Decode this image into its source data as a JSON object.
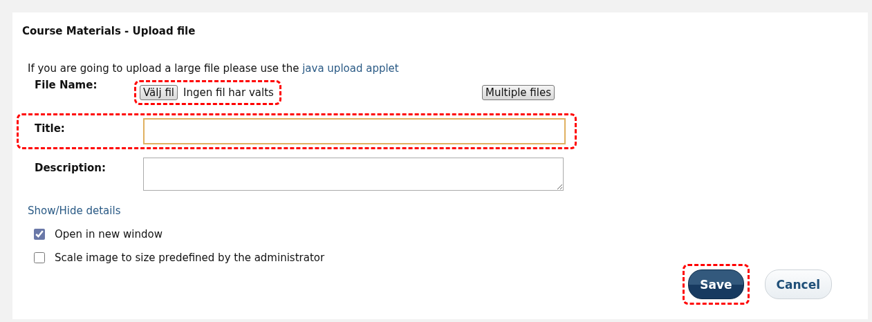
{
  "heading": "Course Materials - Upload file",
  "intro": {
    "text": "If you are going to upload a large file please use the ",
    "link": "java upload applet"
  },
  "file_name": {
    "label": "File Name:",
    "choose_button": "Välj fil",
    "status": "Ingen fil har valts",
    "highlighted": true,
    "multiple_button": "Multiple files"
  },
  "title_field": {
    "label": "Title:",
    "focused": true,
    "highlighted": true
  },
  "description_field": {
    "label": "Description:"
  },
  "details_link": "Show/Hide details",
  "options": [
    {
      "label": "Open in new window",
      "checked": true
    },
    {
      "label": "Scale image to size predefined by the administrator",
      "checked": false
    }
  ],
  "buttons": [
    {
      "label": "Save",
      "kind": "primary",
      "highlighted": true
    },
    {
      "label": "Cancel",
      "kind": "secondary",
      "highlighted": false
    }
  ]
}
